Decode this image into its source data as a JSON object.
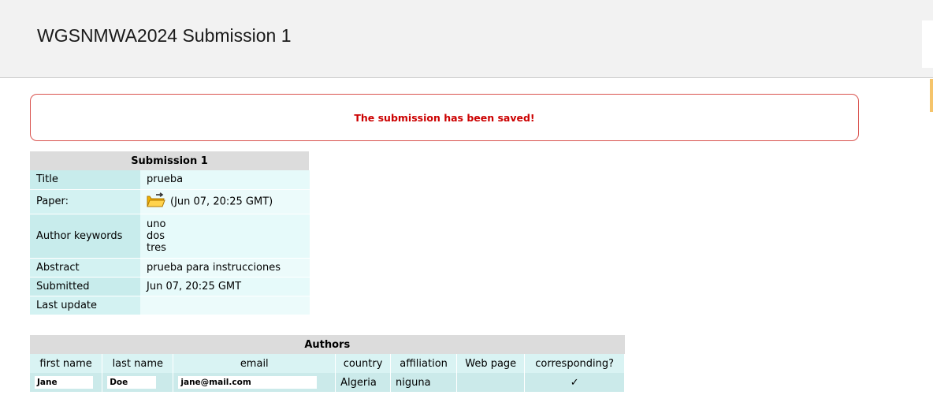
{
  "header": {
    "title": "WGSNMWA2024 Submission 1"
  },
  "notice": {
    "message": "The submission has been saved!"
  },
  "submission": {
    "heading": "Submission 1",
    "rows": [
      {
        "label": "Title",
        "value": "prueba"
      },
      {
        "label": "Paper:",
        "value": "(Jun 07, 20:25 GMT)",
        "icon": "folder-icon"
      },
      {
        "label": "Author keywords",
        "keywords": [
          "uno",
          "dos",
          "tres"
        ]
      },
      {
        "label": "Abstract",
        "value": "prueba para instrucciones"
      },
      {
        "label": "Submitted",
        "value": "Jun 07, 20:25 GMT"
      },
      {
        "label": "Last update",
        "value": ""
      }
    ]
  },
  "authors": {
    "heading": "Authors",
    "columns": [
      "first name",
      "last name",
      "email",
      "country",
      "affiliation",
      "Web page",
      "corresponding?"
    ],
    "rows": [
      {
        "first_name": "Jane",
        "last_name": "Doe",
        "email": "jane@mail.com",
        "country": "Algeria",
        "affiliation": "niguna",
        "web_page": "",
        "corresponding": "✓"
      }
    ]
  },
  "colors": {
    "notice_text": "#cc0000",
    "notice_border": "#d9534f",
    "label_bg": "#c8ecec",
    "value_bg": "#e6fafa",
    "header_bg": "#dcdcdc"
  }
}
